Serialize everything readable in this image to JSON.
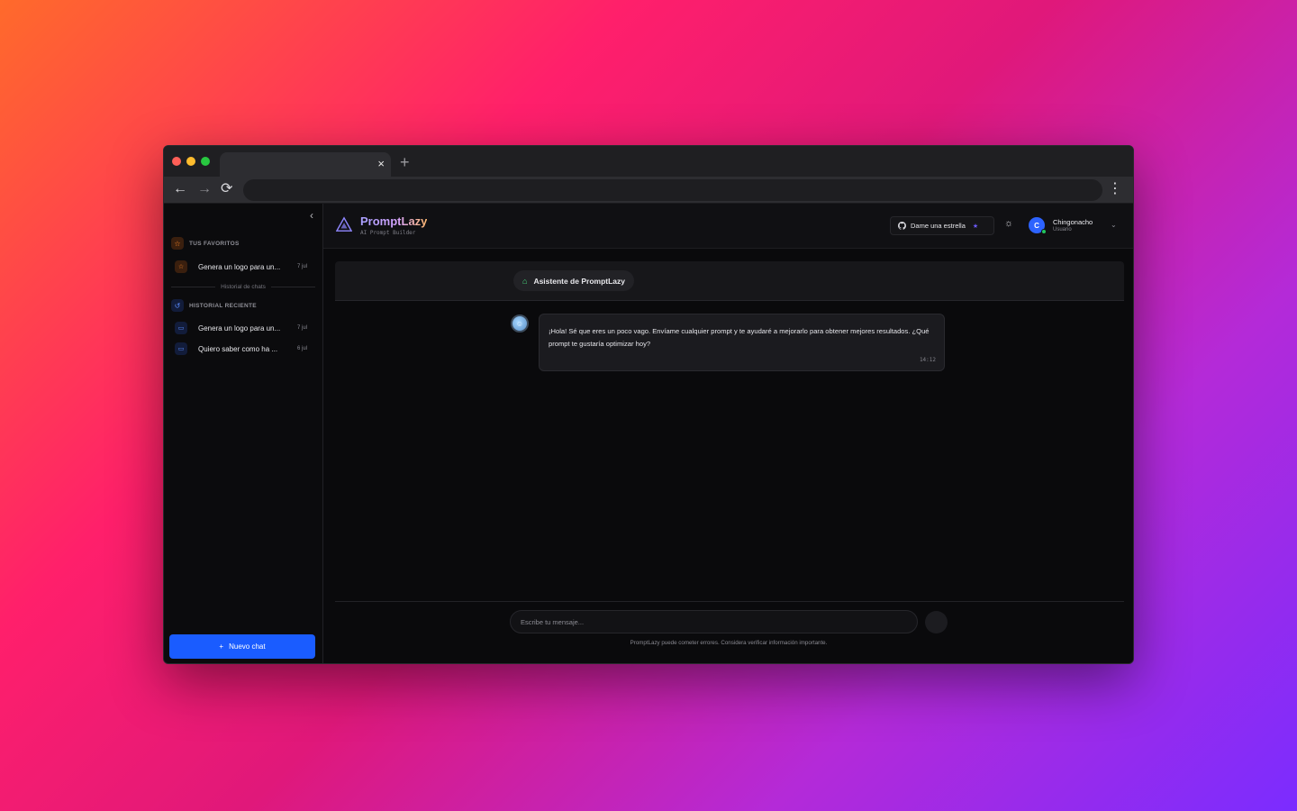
{
  "browser": {
    "tab_close": "×",
    "new_tab": "+",
    "back": "←",
    "forward": "→",
    "reload": "⟳",
    "menu": "⋮"
  },
  "sidebar": {
    "collapse_icon": "‹",
    "favorites_label": "TUS FAVORITOS",
    "favorites": [
      {
        "text": "Genera un logo para un...",
        "date": "7 jul"
      }
    ],
    "divider_label": "Historial de chats",
    "recent_label": "HISTORIAL RECIENTE",
    "recent": [
      {
        "text": "Genera un logo para un...",
        "date": "7 jul"
      },
      {
        "text": "Quiero saber como ha ...",
        "date": "6 jul"
      }
    ],
    "new_chat_icon": "+",
    "new_chat_label": "Nuevo chat"
  },
  "header": {
    "brand": "PromptLazy",
    "tagline": "AI Prompt Builder",
    "star_button_label": "Dame una estrella",
    "user_initial": "C",
    "user_name": "Chingonacho",
    "user_role": "Usuario"
  },
  "chat": {
    "assistant_label": "Asistente de PromptLazy",
    "messages": [
      {
        "text": "¡Hola! Sé que eres un poco vago. Envíame cualquier prompt y te ayudaré a mejorarlo para obtener mejores resultados. ¿Qué prompt te gustaría optimizar hoy?",
        "time": "14:12"
      }
    ],
    "input_placeholder": "Escribe tu mensaje...",
    "disclaimer": "PromptLazy puede cometer errores. Considera verificar información importante."
  },
  "colors": {
    "accent_blue": "#1a5cff",
    "favorite_orange": "#ff8a2a",
    "online_green": "#22c55e"
  }
}
